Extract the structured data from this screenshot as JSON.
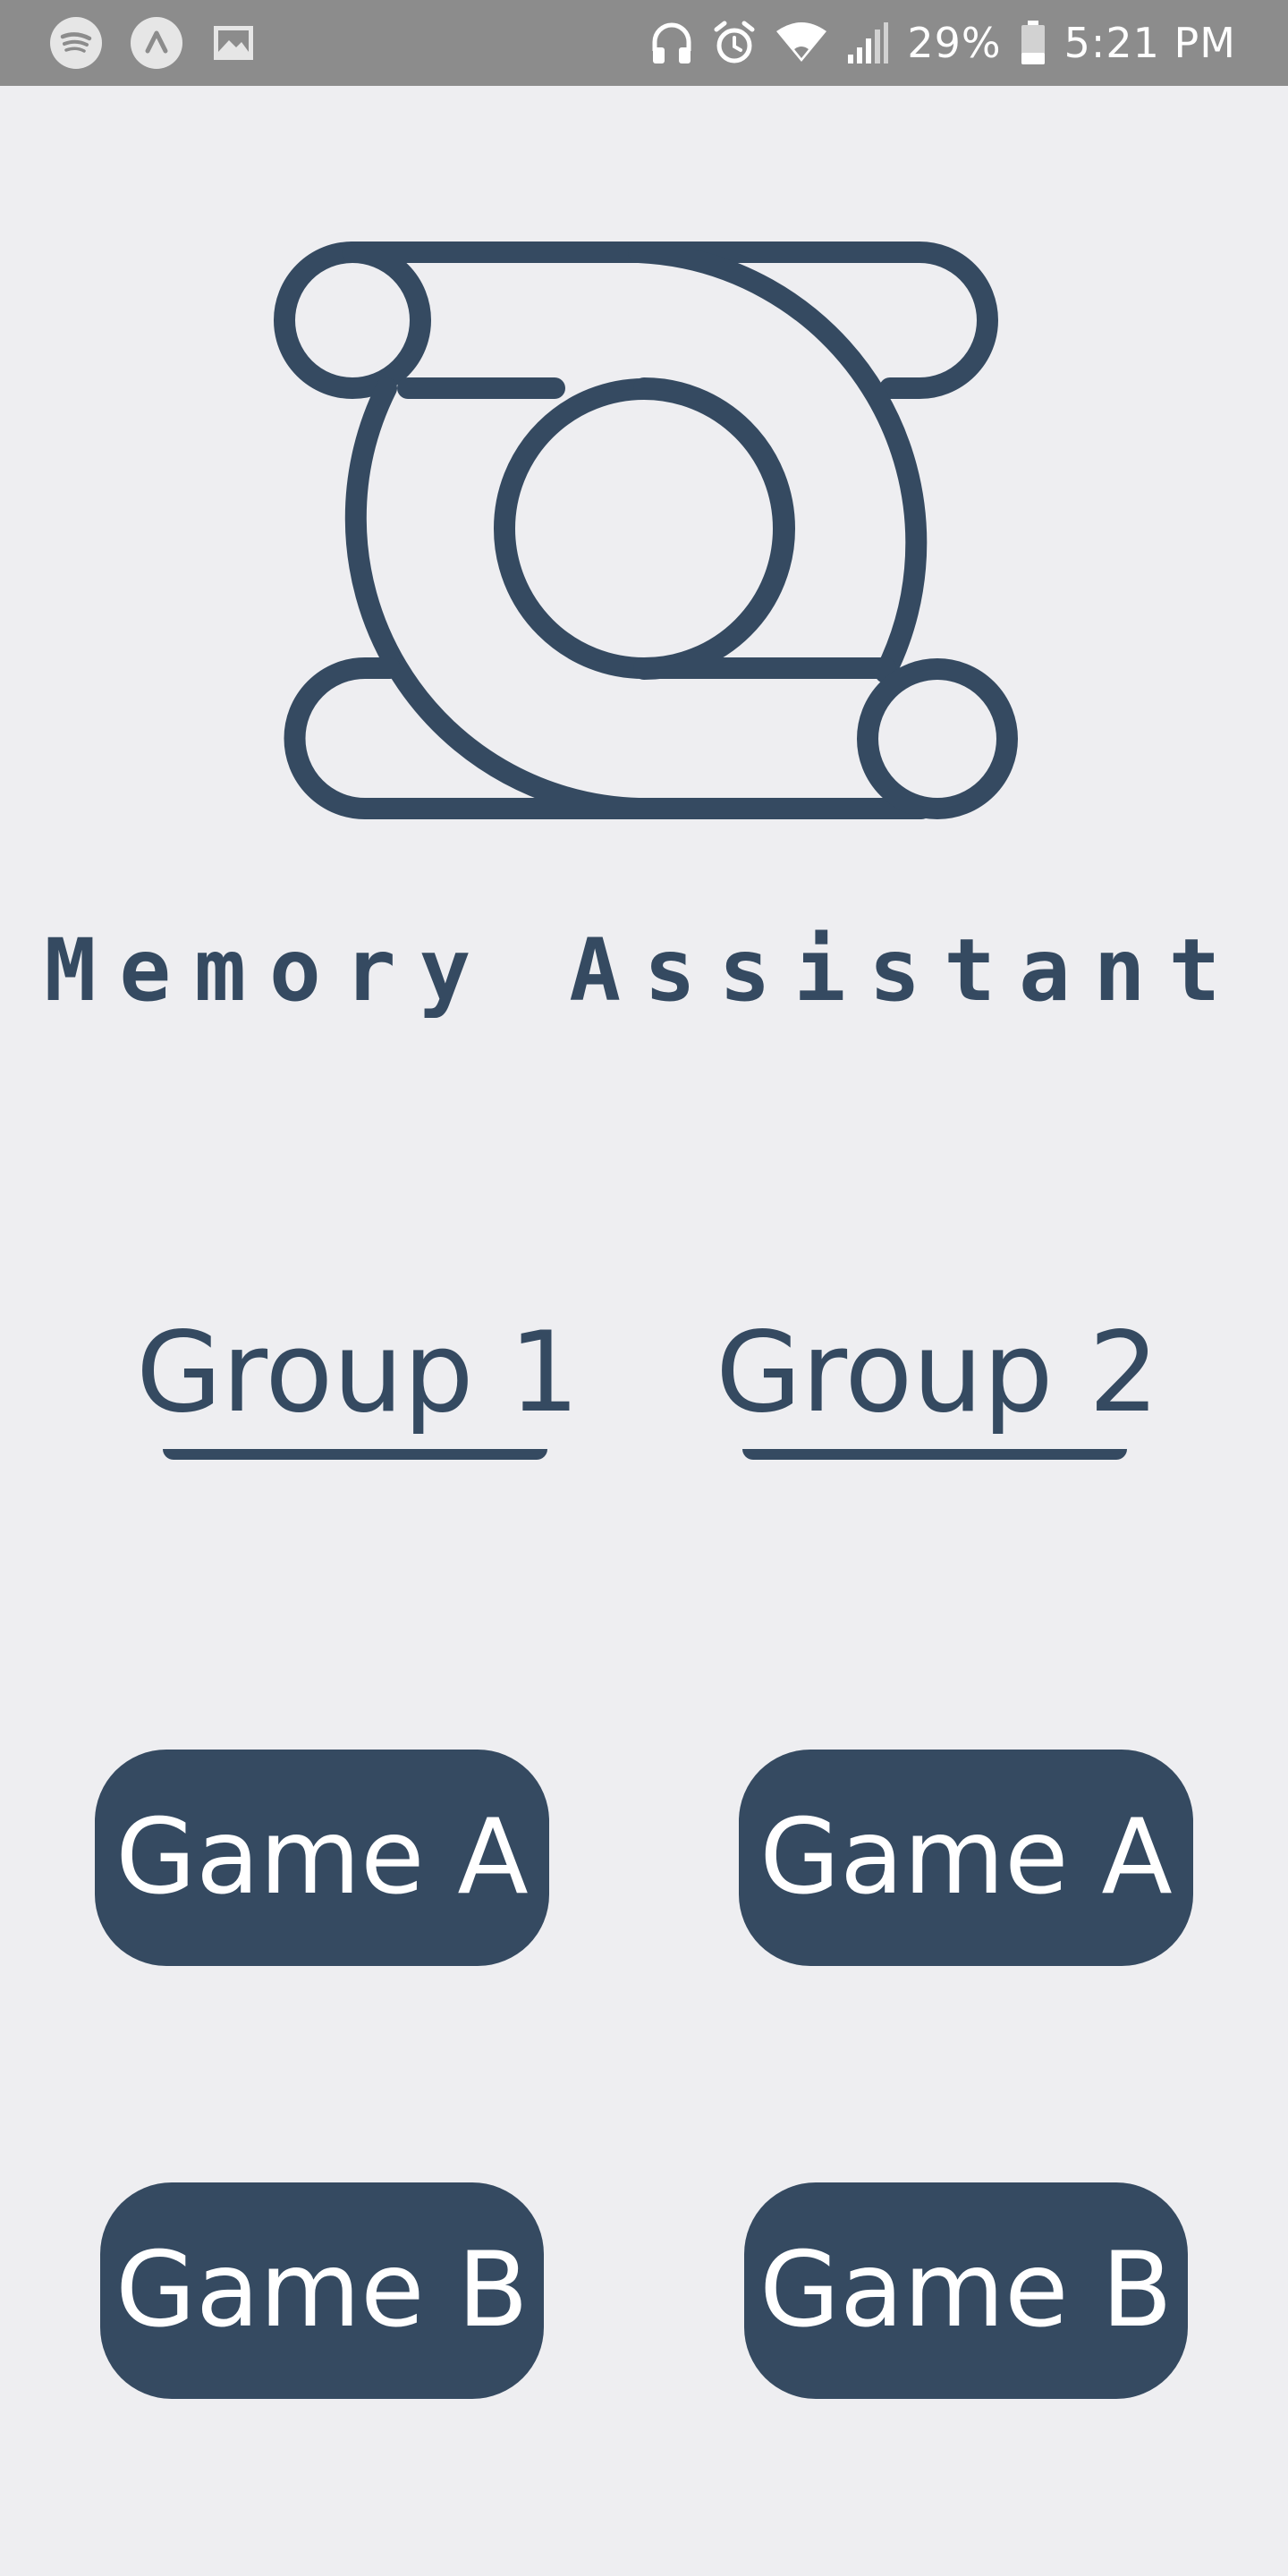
{
  "status_bar": {
    "battery": "29%",
    "time": "5:21 PM",
    "left_icons": [
      "spotify-icon",
      "app-launcher-icon",
      "image-icon"
    ],
    "right_icons": [
      "headphones-icon",
      "alarm-icon",
      "wifi-icon",
      "signal-icon",
      "battery-icon"
    ]
  },
  "app": {
    "title": "Memory Assistant",
    "logo": "memory-assistant-logo",
    "accent_color": "#354a61",
    "background_color": "#eeeef1"
  },
  "groups": [
    {
      "label": "Group 1",
      "games": [
        "Game A",
        "Game B"
      ]
    },
    {
      "label": "Group 2",
      "games": [
        "Game A",
        "Game B"
      ]
    }
  ]
}
